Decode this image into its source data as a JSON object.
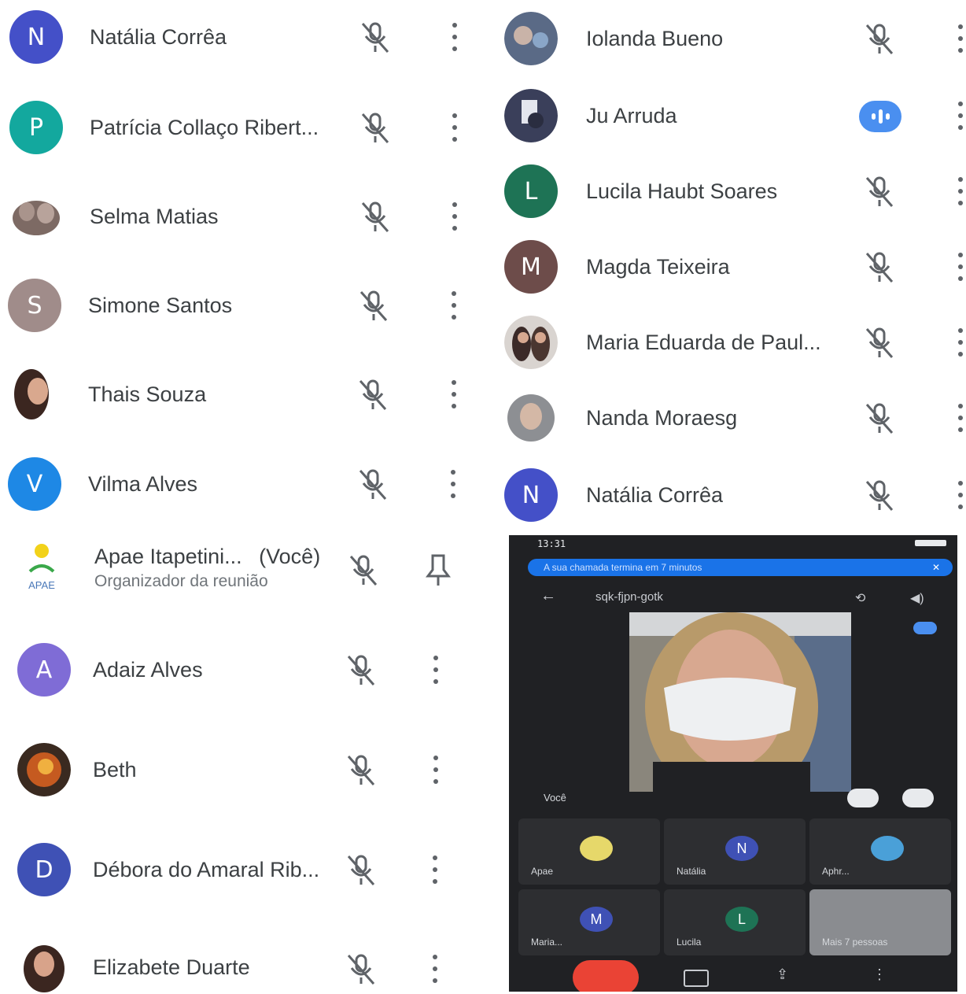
{
  "left_column": [
    {
      "name": "Natália Corrêa",
      "avatar_letter": "N",
      "avatar_color": "#4450c8"
    },
    {
      "name": "Patrícia Collaço Ribert...",
      "avatar_letter": "P",
      "avatar_color": "#13a89e"
    },
    {
      "name": "Selma Matias",
      "avatar_letter": "",
      "avatar_color": "#8b7d78"
    },
    {
      "name": "Simone Santos",
      "avatar_letter": "S",
      "avatar_color": "#a08c8a"
    },
    {
      "name": "Thais Souza",
      "avatar_letter": "",
      "avatar_color": "#5b4035"
    },
    {
      "name": "Vilma Alves",
      "avatar_letter": "V",
      "avatar_color": "#1e88e5"
    },
    {
      "name": "Apae Itapetini...",
      "you_label": "(Você)",
      "subtitle": "Organizador da reunião",
      "avatar_letter": "APAE",
      "avatar_color": "#ffffff"
    },
    {
      "name": "Adaiz Alves",
      "avatar_letter": "A",
      "avatar_color": "#7f6cd6"
    },
    {
      "name": "Beth",
      "avatar_letter": "",
      "avatar_color": "#b8542a"
    },
    {
      "name": "Débora do Amaral Rib...",
      "avatar_letter": "D",
      "avatar_color": "#3f51b5"
    },
    {
      "name": "Elizabete Duarte",
      "avatar_letter": "",
      "avatar_color": "#6a4a3a"
    }
  ],
  "right_column": [
    {
      "name": "Iolanda Bueno",
      "avatar_letter": "",
      "avatar_color": "#5a6a86"
    },
    {
      "name": "Ju Arruda",
      "avatar_letter": "",
      "avatar_color": "#3a3f5a",
      "speaking": true
    },
    {
      "name": "Lucila Haubt Soares",
      "avatar_letter": "L",
      "avatar_color": "#1e7355"
    },
    {
      "name": "Magda Teixeira",
      "avatar_letter": "M",
      "avatar_color": "#6d4c4a"
    },
    {
      "name": "Maria Eduarda de Paul...",
      "avatar_letter": "",
      "avatar_color": "#5a4a4a"
    },
    {
      "name": "Nanda Moraesg",
      "avatar_letter": "",
      "avatar_color": "#8d8f93"
    },
    {
      "name": "Natália Corrêa",
      "avatar_letter": "N",
      "avatar_color": "#4450c8"
    }
  ],
  "phone": {
    "status_time": "13:31",
    "banner_text": "A sua chamada termina em 7 minutos",
    "meeting_code": "sqk-fjpn-gotk",
    "self_label": "Você",
    "tiles": [
      {
        "label": "Apae",
        "letter": "",
        "color": "#e6d86a"
      },
      {
        "label": "Natália",
        "letter": "N",
        "color": "#3f51b5"
      },
      {
        "label": "Aphr...",
        "letter": "",
        "color": "#4aa0d8"
      },
      {
        "label": "Maria...",
        "letter": "M",
        "color": "#3f51b5"
      },
      {
        "label": "Lucila",
        "letter": "L",
        "color": "#1e7355"
      },
      {
        "label": "Mais 7 pessoas",
        "letter": "",
        "color": "#8a8c90"
      }
    ]
  },
  "colors": {
    "icon_grey": "#5f6368",
    "accent_blue": "#4a8ff0",
    "end_call_red": "#ea4335"
  }
}
